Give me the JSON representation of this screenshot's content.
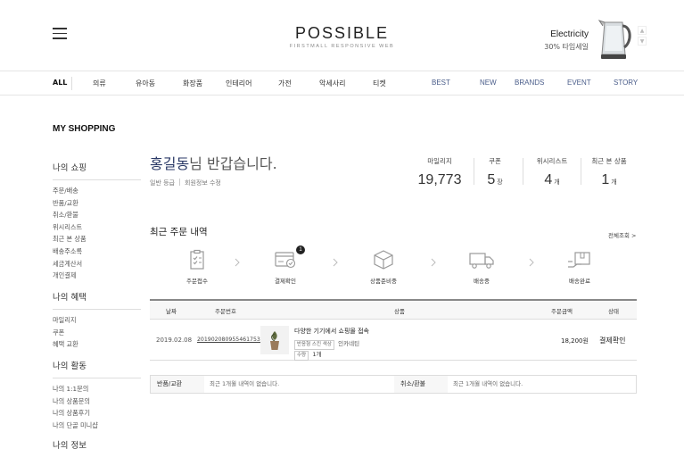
{
  "header": {
    "logo": "POSSIBLE",
    "logo_sub": "FIRSTMALL RESPONSIVE WEB",
    "promo_title": "Electricity",
    "promo_sub": "30% 타임세일"
  },
  "gnb": {
    "items": [
      "ALL",
      "의류",
      "유아동",
      "화장품",
      "인테리어",
      "가전",
      "악세사리",
      "티켓"
    ],
    "en_items": [
      "BEST",
      "NEW",
      "BRANDS",
      "EVENT",
      "STORY"
    ]
  },
  "sidebar": {
    "title": "MY SHOPPING",
    "groups": [
      {
        "title": "나의 쇼핑",
        "items": [
          "주문/배송",
          "반품/교환",
          "취소/환불",
          "위시리스트",
          "최근 본 상품",
          "배송주소록",
          "세금계산서",
          "개인결제"
        ]
      },
      {
        "title": "나의 혜택",
        "items": [
          "마일리지",
          "쿠폰",
          "혜택 교환"
        ]
      },
      {
        "title": "나의 활동",
        "items": [
          "나의 1:1문의",
          "나의 상품문의",
          "나의 상품후기",
          "나의 단골 미니샵"
        ]
      },
      {
        "title": "나의 정보",
        "items": []
      }
    ]
  },
  "greeting": {
    "name": "홍길동",
    "suffix": "님 반갑습니다.",
    "grade": "일반 등급",
    "edit_link": "회원정보 수정"
  },
  "stats": [
    {
      "label": "마일리지",
      "value": "19,773",
      "unit": ""
    },
    {
      "label": "쿠폰",
      "value": "5",
      "unit": "장"
    },
    {
      "label": "위시리스트",
      "value": "4",
      "unit": "개"
    },
    {
      "label": "최근 본 상품",
      "value": "1",
      "unit": "개"
    }
  ],
  "orders": {
    "title": "최근 주문 내역",
    "view_all": "전체조회 >",
    "steps": [
      {
        "label": "주문접수",
        "icon": "clipboard-icon"
      },
      {
        "label": "결제확인",
        "icon": "card-check-icon",
        "badge": "1"
      },
      {
        "label": "상품준비중",
        "icon": "box-icon"
      },
      {
        "label": "배송중",
        "icon": "truck-icon"
      },
      {
        "label": "배송완료",
        "icon": "delivered-icon"
      }
    ],
    "columns": [
      "날짜",
      "주문번호",
      "상품",
      "주문금액",
      "상태"
    ],
    "rows": [
      {
        "date": "2019.02.08",
        "order_no": "2019020809554617530",
        "product": "다양한 기기에서 쇼핑몰 접속",
        "option_tag": "반응형 스킨 색상",
        "option_value": "인카네틴",
        "qty_tag": "수량",
        "qty": "1개",
        "amount": "18,200원",
        "status": "결제확인"
      }
    ]
  },
  "empty": {
    "return_label": "반품/교환",
    "return_text": "최근 1개월 내역이 없습니다.",
    "cancel_label": "취소/환불",
    "cancel_text": "최근 1개월 내역이 없습니다."
  },
  "colors": {
    "accent": "#2b3a67",
    "nav_en": "#4a5d8a"
  }
}
